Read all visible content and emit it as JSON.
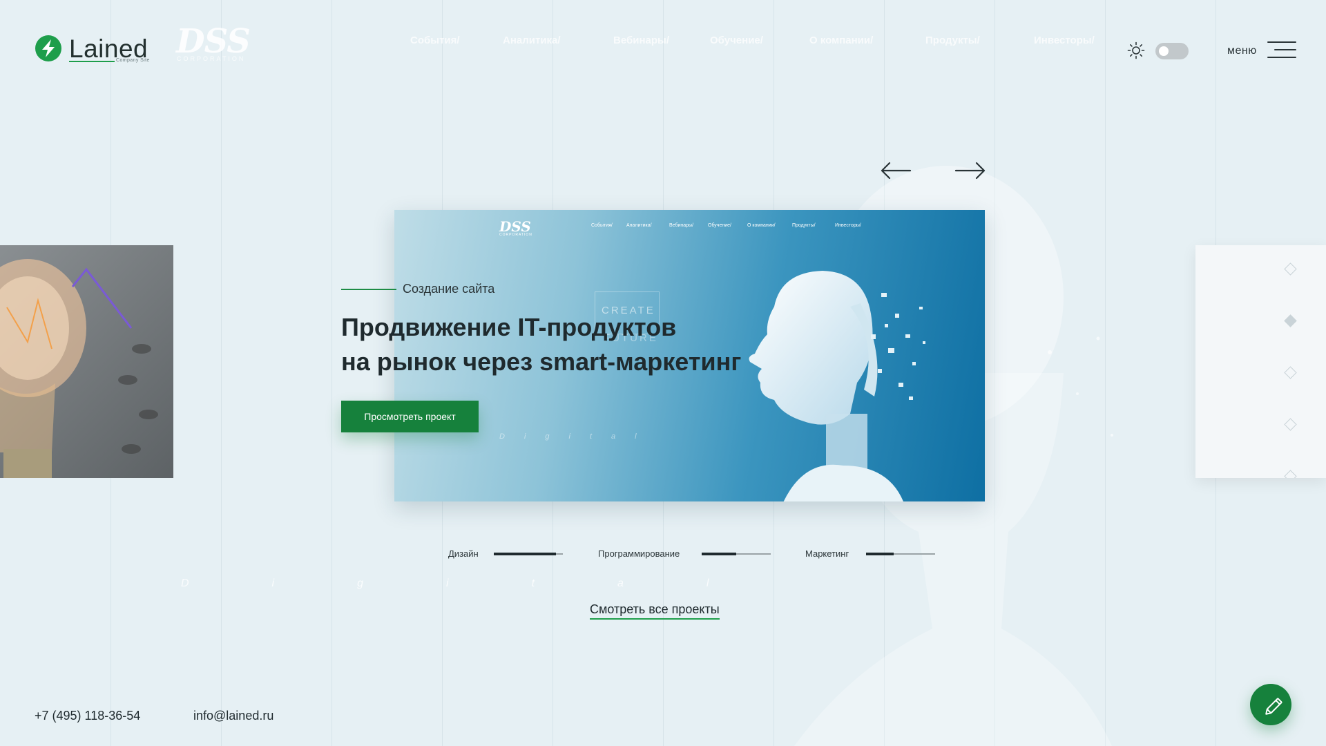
{
  "header": {
    "logo_text": "Lained",
    "logo_sub": "Company Site",
    "ghost_logo": "DSS",
    "ghost_logo_sub": "CORPORATION",
    "ghost_nav": [
      "События/",
      "Аналитика/",
      "Вебинары/",
      "Обучение/",
      "О компании/",
      "Продукты/",
      "Инвесторы/"
    ],
    "menu_label": "меню"
  },
  "slide": {
    "mini_logo": "DSS",
    "mini_logo_sub": "CORPORATION",
    "mini_nav": [
      "События/",
      "Аналитика/",
      "Вебинары/",
      "Обучение/",
      "О компании/",
      "Продукты/",
      "Инвесторы/"
    ],
    "create_text": "CREATE",
    "future_text": "FUTURE",
    "digital_text": "Digital"
  },
  "project": {
    "subtitle": "Создание сайта",
    "headline_line1": "Продвижение IT-продуктов",
    "headline_line2": "на рынок через smart-маркетинг",
    "view_button": "Просмотреть проект"
  },
  "skills": [
    {
      "label": "Дизайн",
      "level": 0.9
    },
    {
      "label": "Программирование",
      "level": 0.5
    },
    {
      "label": "Маркетинг",
      "level": 0.4
    }
  ],
  "ghost_digital": "Digital",
  "all_projects_link": "Смотреть все проекты",
  "footer": {
    "phone": "+7 (495) 118-36-54",
    "email": "info@lained.ru"
  },
  "colors": {
    "accent": "#16813c",
    "background": "#e6f0f4",
    "text": "#1f2a2e"
  },
  "icons": [
    "logo-mark-icon",
    "sun-icon",
    "toggle-switch",
    "hamburger-icon",
    "arrow-left-icon",
    "arrow-right-icon",
    "pencil-icon"
  ]
}
